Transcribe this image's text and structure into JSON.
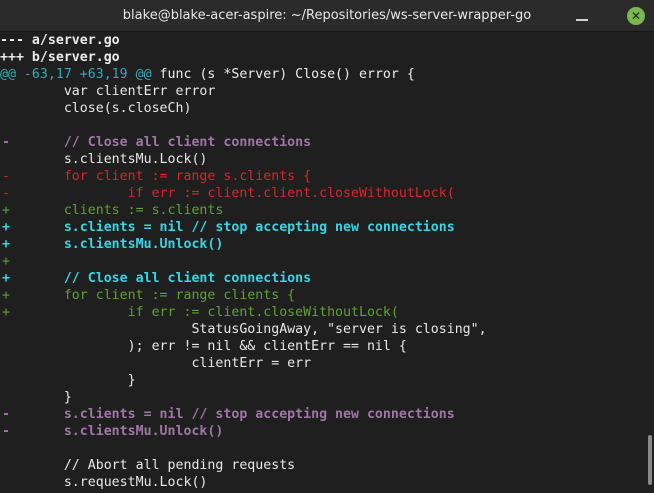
{
  "window": {
    "title": "blake@blake-acer-aspire: ~/Repositories/ws-server-wrapper-go",
    "close_glyph": "✕"
  },
  "diff": {
    "file_old": "--- a/server.go",
    "file_new": "+++ b/server.go",
    "hunk_range": "@@ -63,17 +63,19 @@",
    "hunk_context": " func (s *Server) Close() error {",
    "lines": [
      {
        "sign": "",
        "text": "        var clientErr error"
      },
      {
        "sign": "",
        "text": "        close(s.closeCh)"
      },
      {
        "sign": "",
        "text": ""
      },
      {
        "sign": "-",
        "text": "        // Close all client connections"
      },
      {
        "sign": "",
        "text": "        s.clientsMu.Lock()"
      },
      {
        "sign": "-",
        "text": "        for client := range s.clients {"
      },
      {
        "sign": "-",
        "text": "                if err := client.client.closeWithoutLock("
      },
      {
        "sign": "+",
        "text": "        clients := s.clients"
      },
      {
        "sign": "+",
        "text": "        s.clients = nil // stop accepting new connections"
      },
      {
        "sign": "+",
        "text": "        s.clientsMu.Unlock()"
      },
      {
        "sign": "+",
        "text": ""
      },
      {
        "sign": "+",
        "text": "        // Close all client connections"
      },
      {
        "sign": "+",
        "text": "        for client := range clients {"
      },
      {
        "sign": "+",
        "text": "                if err := client.closeWithoutLock("
      },
      {
        "sign": "",
        "text": "                        StatusGoingAway, \"server is closing\","
      },
      {
        "sign": "",
        "text": "                ); err != nil && clientErr == nil {"
      },
      {
        "sign": "",
        "text": "                        clientErr = err"
      },
      {
        "sign": "",
        "text": "                }"
      },
      {
        "sign": "",
        "text": "        }"
      },
      {
        "sign": "-",
        "text": "        s.clients = nil // stop accepting new connections"
      },
      {
        "sign": "-",
        "text": "        s.clientsMu.Unlock()"
      },
      {
        "sign": "",
        "text": ""
      },
      {
        "sign": "",
        "text": "        // Abort all pending requests"
      },
      {
        "sign": "",
        "text": "        s.requestMu.Lock()"
      }
    ]
  },
  "colors": {
    "background": "#1f1f1f",
    "default_text": "#e8e8e8",
    "hunk_header": "#3aa7b5",
    "moved_removed": "#9f77a5",
    "removed": "#d8262a",
    "added": "#5fa136",
    "moved_added": "#38d6e2",
    "close_button": "#7ab84f"
  }
}
